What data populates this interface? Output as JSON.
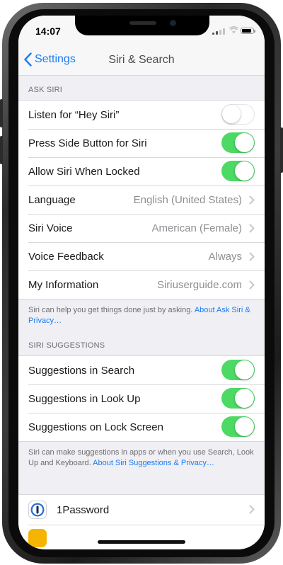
{
  "status_bar": {
    "time": "14:07"
  },
  "nav": {
    "back_label": "Settings",
    "title": "Siri & Search"
  },
  "ask_siri": {
    "header": "ASK SIRI",
    "rows": [
      {
        "label": "Listen for “Hey Siri”",
        "toggle": false
      },
      {
        "label": "Press Side Button for Siri",
        "toggle": true
      },
      {
        "label": "Allow Siri When Locked",
        "toggle": true
      },
      {
        "label": "Language",
        "value": "English (United States)"
      },
      {
        "label": "Siri Voice",
        "value": "American (Female)"
      },
      {
        "label": "Voice Feedback",
        "value": "Always"
      },
      {
        "label": "My Information",
        "value": "Siriuserguide.com"
      }
    ],
    "footer_text": "Siri can help you get things done just by asking. ",
    "footer_link": "About Ask Siri & Privacy…"
  },
  "siri_suggestions": {
    "header": "SIRI SUGGESTIONS",
    "rows": [
      {
        "label": "Suggestions in Search",
        "toggle": true
      },
      {
        "label": "Suggestions in Look Up",
        "toggle": true
      },
      {
        "label": "Suggestions on Lock Screen",
        "toggle": true
      }
    ],
    "footer_text": "Siri can make suggestions in apps or when you use Search, Look Up and Keyboard. ",
    "footer_link": "About Siri Suggestions & Privacy…"
  },
  "apps": [
    {
      "label": "1Password",
      "icon": "1password-icon"
    }
  ],
  "colors": {
    "accent": "#1a7cf3",
    "toggle_on": "#4cd964"
  }
}
